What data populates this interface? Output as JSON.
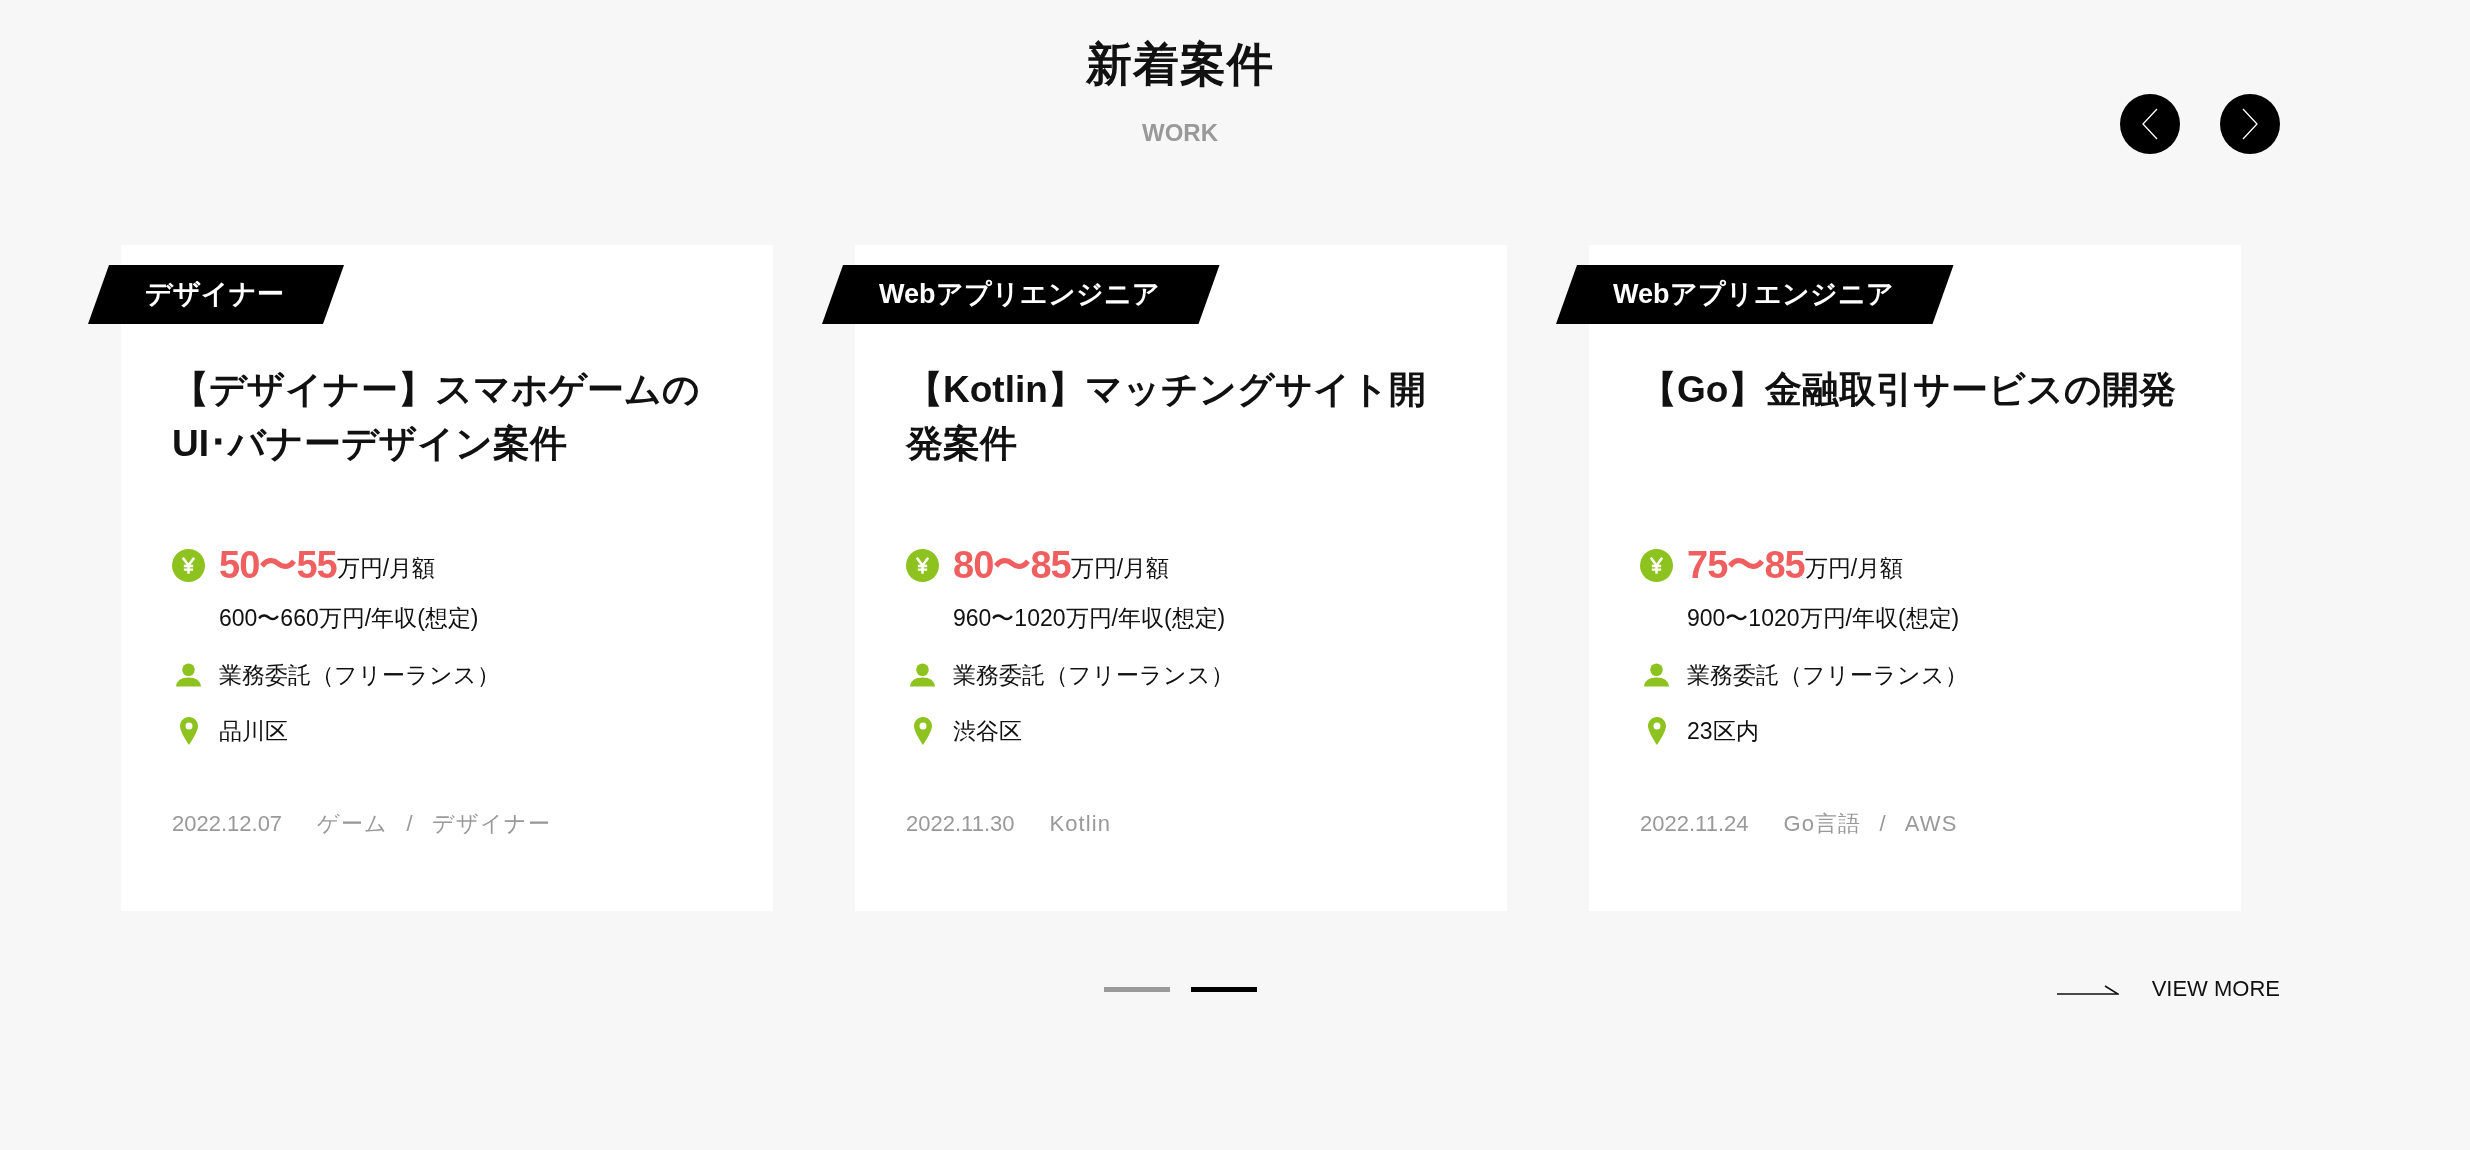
{
  "section": {
    "title": "新着案件",
    "subtitle": "WORK"
  },
  "cards": [
    {
      "category": "デザイナー",
      "title": "【デザイナー】スマホゲームのUI･バナーデザイン案件",
      "salary": "50〜55",
      "salary_unit": "万円/月額",
      "annual": "600〜660万円/年収(想定)",
      "contract": "業務委託（フリーランス）",
      "location": "品川区",
      "date": "2022.12.07",
      "tags": "ゲーム / デザイナー"
    },
    {
      "category": "Webアプリエンジニア",
      "title": "【Kotlin】マッチングサイト開発案件",
      "salary": "80〜85",
      "salary_unit": "万円/月額",
      "annual": "960〜1020万円/年収(想定)",
      "contract": "業務委託（フリーランス）",
      "location": "渋谷区",
      "date": "2022.11.30",
      "tags": "Kotlin"
    },
    {
      "category": "Webアプリエンジニア",
      "title": "【Go】金融取引サービスの開発",
      "salary": "75〜85",
      "salary_unit": "万円/月額",
      "annual": "900〜1020万円/年収(想定)",
      "contract": "業務委託（フリーランス）",
      "location": "23区内",
      "date": "2022.11.24",
      "tags": "Go言語 / AWS"
    }
  ],
  "pagination": [
    {
      "selected": false
    },
    {
      "selected": true
    }
  ],
  "view_more": "VIEW MORE"
}
